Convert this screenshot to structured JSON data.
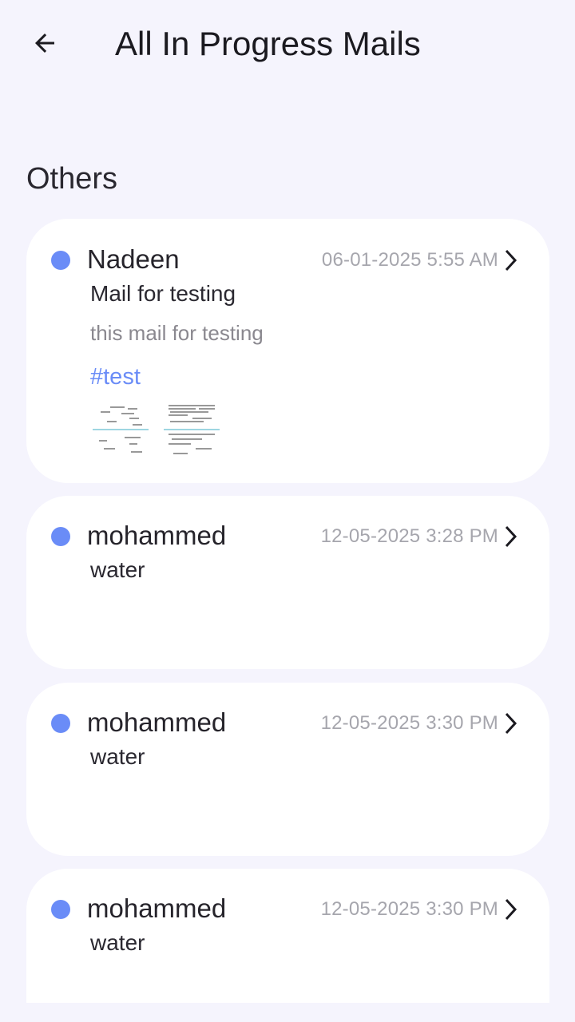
{
  "header": {
    "title": "All In Progress Mails",
    "back_icon": "arrow-left-icon"
  },
  "section": {
    "heading": "Others"
  },
  "mails": [
    {
      "sender": "Nadeen",
      "timestamp": "06-01-2025 5:55 AM",
      "subject": "Mail for testing",
      "preview": "this mail for testing",
      "tag": "#test",
      "attachments": [
        "document-thumbnail-1",
        "document-thumbnail-2"
      ]
    },
    {
      "sender": "mohammed",
      "timestamp": "12-05-2025 3:28 PM",
      "subject": "water"
    },
    {
      "sender": "mohammed",
      "timestamp": "12-05-2025 3:30 PM",
      "subject": "water"
    },
    {
      "sender": "mohammed",
      "timestamp": "12-05-2025 3:30 PM",
      "subject": "water"
    }
  ],
  "colors": {
    "background": "#f5f4fd",
    "card": "#ffffff",
    "unread_dot": "#6a8cf7",
    "tag": "#6a8cf7",
    "timestamp": "#a6a6ad"
  }
}
